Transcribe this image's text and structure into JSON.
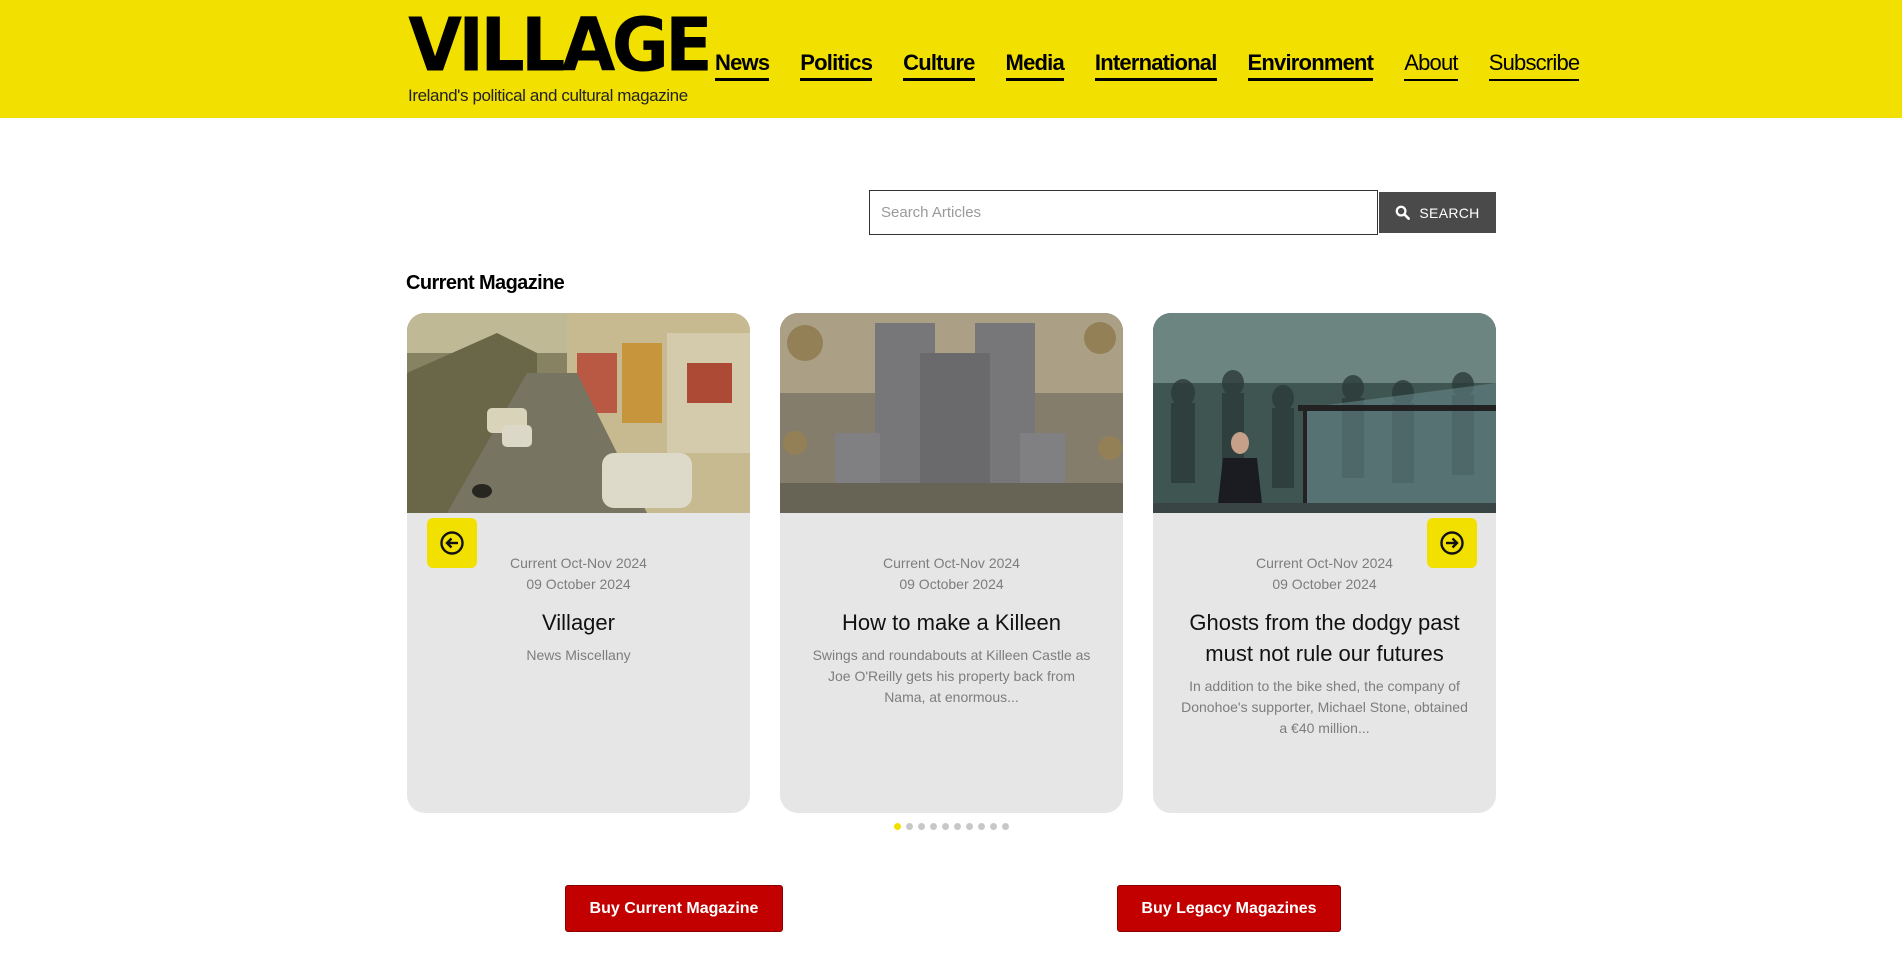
{
  "header": {
    "logo": "VILLAGE",
    "tagline": "Ireland's political and cultural magazine",
    "nav": [
      {
        "label": "News"
      },
      {
        "label": "Politics"
      },
      {
        "label": "Culture"
      },
      {
        "label": "Media"
      },
      {
        "label": "International"
      },
      {
        "label": "Environment"
      },
      {
        "label": "About"
      },
      {
        "label": "Subscribe"
      }
    ]
  },
  "search": {
    "placeholder": "Search Articles",
    "value": "",
    "button_label": "SEARCH",
    "button_icon": "search-icon"
  },
  "section": {
    "title": "Current Magazine"
  },
  "carousel": {
    "prev_icon": "arrow-left-circle-icon",
    "next_icon": "arrow-right-circle-icon",
    "cards": [
      {
        "issue": "Current Oct-Nov 2024",
        "date": "09 October 2024",
        "title": "Villager",
        "description": "News Miscellany",
        "image": "irish-town-street-photo"
      },
      {
        "issue": "Current Oct-Nov 2024",
        "date": "09 October 2024",
        "title": "How to make a Killeen",
        "description": "Swings and roundabouts at Killeen Castle as Joe O'Reilly gets his property back from Nama, at enormous...",
        "image": "bad-bank-castle-illustration"
      },
      {
        "issue": "Current Oct-Nov 2024",
        "date": "09 October 2024",
        "title": "Ghosts from the dodgy past must not rule our futures",
        "description": "In addition to the bike shed, the company of Donohoe's supporter, Michael Stone, obtained a €40 million...",
        "image": "opw-ghosts-illustration"
      }
    ],
    "page_count": 10,
    "active_page": 1
  },
  "actions": {
    "buy_current": "Buy Current Magazine",
    "buy_legacy": "Buy Legacy Magazines"
  },
  "colors": {
    "brand_yellow": "#f2e000",
    "buy_red": "#c20000",
    "search_button": "#4a4a4a",
    "card_bg": "#e6e6e6"
  }
}
